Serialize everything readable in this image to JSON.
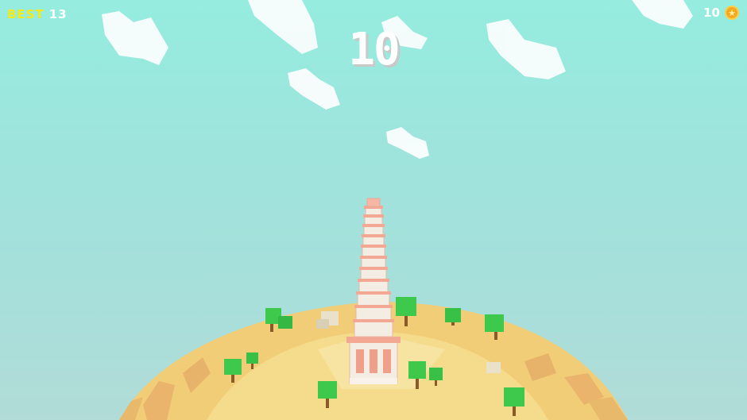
{
  "hud": {
    "best_label": "BEST",
    "best_value": "13",
    "score": "10",
    "coins": "10",
    "coin_icon": "star-coin-icon"
  },
  "colors": {
    "sky_top": "#95ecdf",
    "sky_bottom": "#b1dcd8",
    "best_label": "#f3ea16",
    "sand": "#f3d27c",
    "tower": "#f3ece4",
    "tower_accent": "#f0a08a",
    "tree": "#3fc94c",
    "coin": "#f6a821"
  }
}
